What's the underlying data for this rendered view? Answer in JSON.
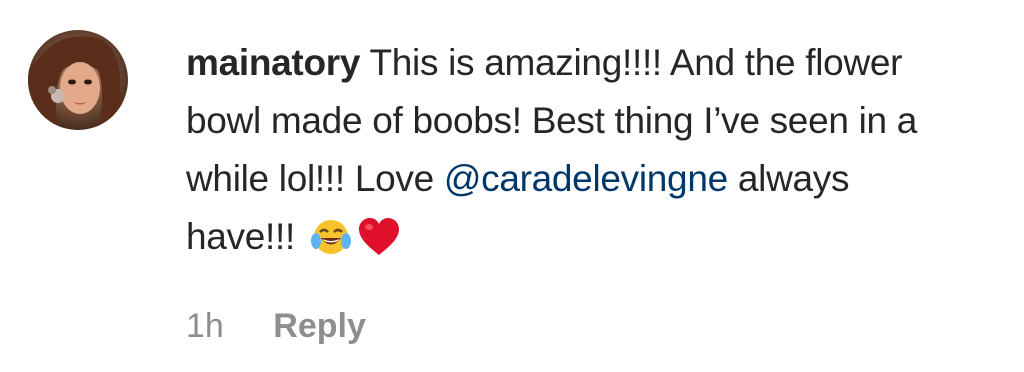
{
  "comment": {
    "username": "mainatory",
    "text_part1": " This is amazing!!!! And the flower bowl made of boobs! Best thing I’ve seen in a while lol!!! Love ",
    "mention": "@caradelevingne",
    "text_part2": " always have!!! ",
    "emojis": [
      "face-with-tears-of-joy",
      "red-heart"
    ],
    "timestamp": "1h",
    "reply_label": "Reply"
  },
  "colors": {
    "text": "#262626",
    "mention": "#00376b",
    "meta": "#8e8e8e",
    "heart": "#e0102a",
    "joy_face": "#f7c22b"
  }
}
